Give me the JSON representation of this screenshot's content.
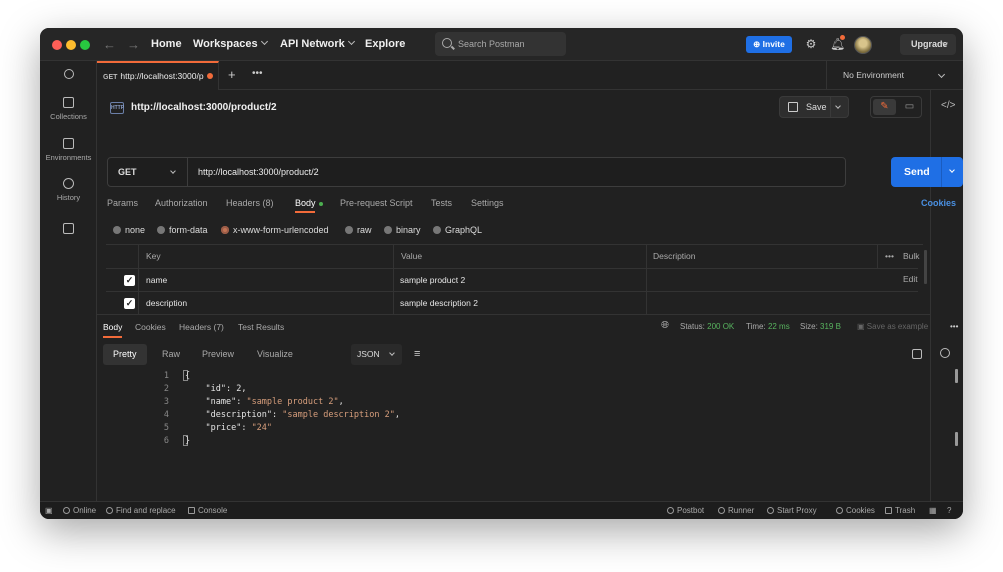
{
  "titlebar": {
    "menu": [
      {
        "label": "Home",
        "has_chevron": false
      },
      {
        "label": "Workspaces",
        "has_chevron": true
      },
      {
        "label": "API Network",
        "has_chevron": true
      },
      {
        "label": "Explore",
        "has_chevron": false
      }
    ],
    "search_placeholder": "Search Postman",
    "invite_label": "Invite",
    "upgrade_label": "Upgrade"
  },
  "sidebar": {
    "items": [
      {
        "label": "Collections",
        "icon": "collections-icon"
      },
      {
        "label": "Environments",
        "icon": "environments-icon"
      },
      {
        "label": "History",
        "icon": "history-icon"
      }
    ]
  },
  "tab": {
    "method": "GET",
    "title": "http://localhost:3000/p",
    "environment": "No Environment"
  },
  "request": {
    "badge": "HTTP",
    "title": "http://localhost:3000/product/2",
    "save_label": "Save",
    "method": "GET",
    "url": "http://localhost:3000/product/2",
    "send_label": "Send",
    "tabs": [
      "Params",
      "Authorization",
      "Headers (8)",
      "Body",
      "Pre-request Script",
      "Tests",
      "Settings"
    ],
    "active_tab": "Body",
    "cookies_label": "Cookies",
    "body_modes": [
      "none",
      "form-data",
      "x-www-form-urlencoded",
      "raw",
      "binary",
      "GraphQL"
    ],
    "selected_body_mode": "x-www-form-urlencoded",
    "table": {
      "headers": {
        "key": "Key",
        "value": "Value",
        "description": "Description",
        "bulk_edit": "Bulk Edit"
      },
      "rows": [
        {
          "checked": true,
          "key": "name",
          "value": "sample product 2",
          "description": ""
        },
        {
          "checked": true,
          "key": "description",
          "value": "sample description 2",
          "description": ""
        }
      ]
    }
  },
  "response": {
    "tabs": [
      "Body",
      "Cookies",
      "Headers (7)",
      "Test Results"
    ],
    "active_tab": "Body",
    "status_label": "Status:",
    "status_value": "200 OK",
    "time_label": "Time:",
    "time_value": "22 ms",
    "size_label": "Size:",
    "size_value": "319 B",
    "save_example": "Save as example",
    "formats": [
      "Pretty",
      "Raw",
      "Preview",
      "Visualize"
    ],
    "active_format": "Pretty",
    "language": "JSON",
    "code_lines": [
      {
        "n": "1",
        "text": "{"
      },
      {
        "n": "2",
        "key": "\"id\"",
        "value": "2",
        "type": "number"
      },
      {
        "n": "3",
        "key": "\"name\"",
        "value": "\"sample product 2\"",
        "type": "string"
      },
      {
        "n": "4",
        "key": "\"description\"",
        "value": "\"sample description 2\"",
        "type": "string"
      },
      {
        "n": "5",
        "key": "\"price\"",
        "value": "\"24\"",
        "type": "string",
        "last": true
      },
      {
        "n": "6",
        "text": "}"
      }
    ]
  },
  "statusbar": {
    "left": [
      "Online",
      "Find and replace",
      "Console"
    ],
    "right": [
      "Postbot",
      "Runner",
      "Start Proxy",
      "Cookies",
      "Trash"
    ]
  },
  "colors": {
    "accent_blue": "#1f6fe5",
    "accent_orange": "#f26b3a",
    "status_green": "#58b45f",
    "background": "#212121"
  }
}
